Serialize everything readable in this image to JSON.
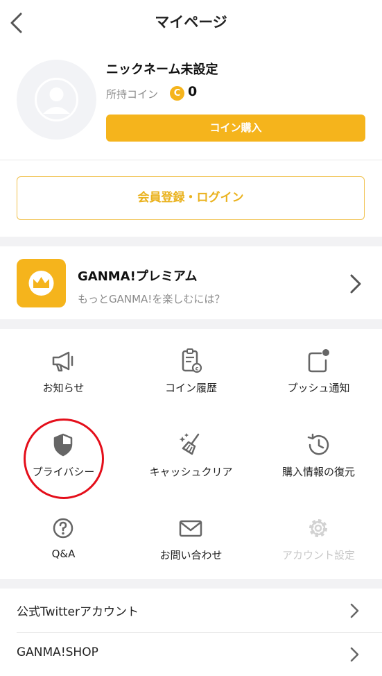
{
  "header": {
    "title": "マイページ"
  },
  "profile": {
    "nickname": "ニックネーム未設定",
    "coin_label": "所持コイン",
    "coin_badge": "C",
    "coin_count": "0",
    "buy_button": "コイン購入"
  },
  "login_button": "会員登録・ログイン",
  "premium": {
    "title": "GANMA!プレミアム",
    "subtitle": "もっとGANMA!を楽しむには？"
  },
  "menu": [
    {
      "label": "お知らせ",
      "icon": "megaphone-icon",
      "enabled": true
    },
    {
      "label": "コイン履歴",
      "icon": "coin-history-icon",
      "enabled": true
    },
    {
      "label": "プッシュ通知",
      "icon": "push-notification-icon",
      "enabled": true
    },
    {
      "label": "プライバシー",
      "icon": "shield-icon",
      "enabled": true
    },
    {
      "label": "キャッシュクリア",
      "icon": "broom-icon",
      "enabled": true
    },
    {
      "label": "購入情報の復元",
      "icon": "restore-icon",
      "enabled": true
    },
    {
      "label": "Q&A",
      "icon": "question-icon",
      "enabled": true
    },
    {
      "label": "お問い合わせ",
      "icon": "envelope-icon",
      "enabled": true
    },
    {
      "label": "アカウント設定",
      "icon": "gear-icon",
      "enabled": false
    }
  ],
  "list": [
    {
      "label": "公式Twitterアカウント"
    },
    {
      "label": "GANMA!SHOP"
    }
  ],
  "colors": {
    "accent": "#f5b41c",
    "highlight": "#e40e1a",
    "disabled": "#c8c8c8"
  }
}
